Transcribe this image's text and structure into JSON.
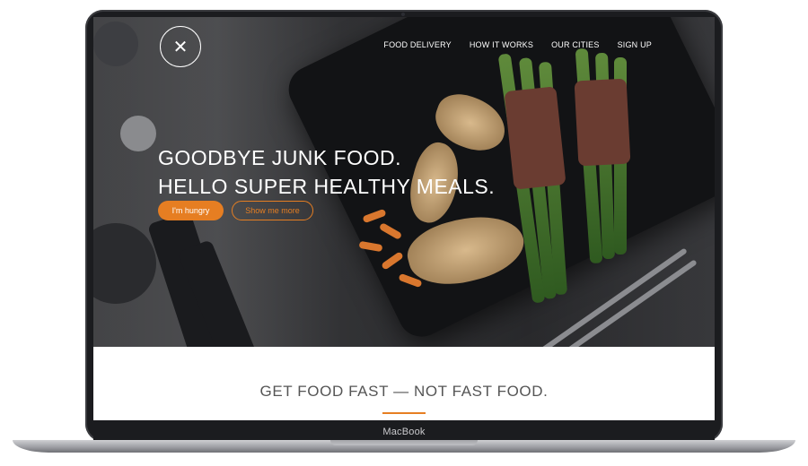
{
  "nav": {
    "logo_icon": "fork-spoon-icon",
    "items": [
      {
        "label": "FOOD DELIVERY"
      },
      {
        "label": "HOW IT WORKS"
      },
      {
        "label": "OUR CITIES"
      },
      {
        "label": "SIGN UP"
      }
    ]
  },
  "hero": {
    "headline_line1": "GOODBYE JUNK FOOD.",
    "headline_line2": "HELLO SUPER HEALTHY MEALS.",
    "primary_button": "I'm hungry",
    "secondary_button": "Show me more"
  },
  "section": {
    "title": "GET FOOD FAST — NOT FAST FOOD."
  },
  "device": {
    "label": "MacBook"
  },
  "colors": {
    "accent": "#e67e22",
    "text_dark": "#555555"
  }
}
